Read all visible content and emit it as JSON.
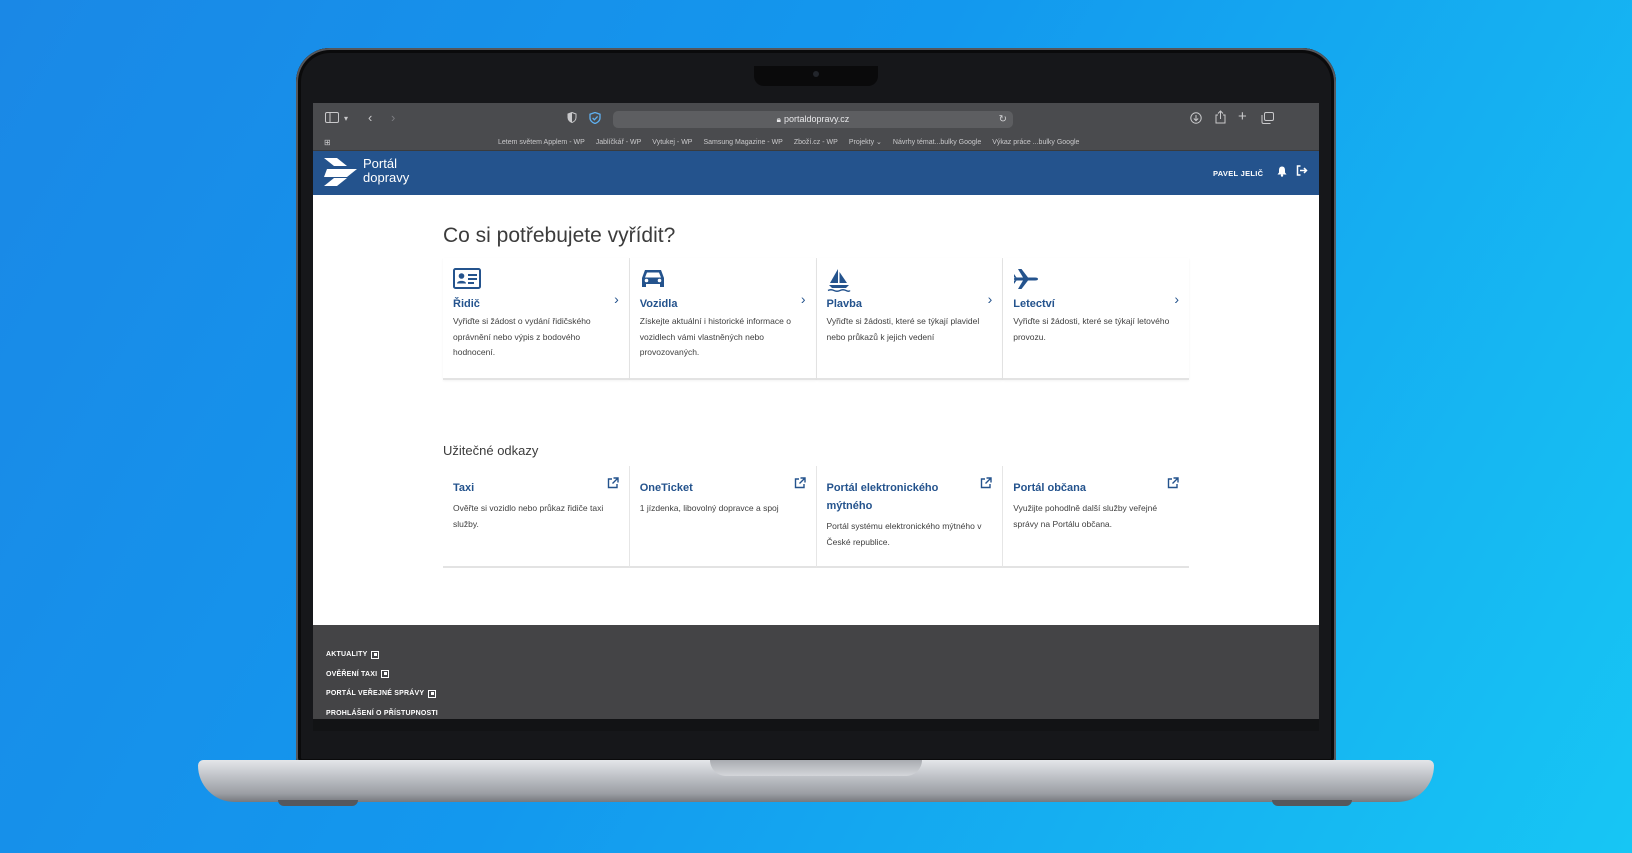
{
  "browser": {
    "url": "portaldopravy.cz",
    "bookmarks": [
      "Letem světem Applem - WP",
      "Jablíčkář - WP",
      "Vytukej - WP",
      "Samsung Magazine - WP",
      "Zboží.cz - WP",
      "Projekty ⌄",
      "Návrhy témat...bulky Google",
      "Výkaz práce ...bulky Google"
    ]
  },
  "header": {
    "logo_line1": "Portál",
    "logo_line2": "dopravy",
    "user_name": "PAVEL JELIČ"
  },
  "main": {
    "title": "Co si potřebujete vyřídit?",
    "services": [
      {
        "title": "Řidič",
        "desc": "Vyřiďte si žádost o vydání řidičského oprávnění nebo výpis z bodového hodnocení.",
        "icon": "driver-license-icon"
      },
      {
        "title": "Vozidla",
        "desc": "Získejte aktuální i historické informace o vozidlech vámi vlastněných nebo provozovaných.",
        "icon": "car-icon"
      },
      {
        "title": "Plavba",
        "desc": "Vyřiďte si žádosti, které se týkají plavidel nebo průkazů k jejich vedení",
        "icon": "sailboat-icon"
      },
      {
        "title": "Letectví",
        "desc": "Vyřiďte si žádosti, které se týkají letového provozu.",
        "icon": "airplane-icon"
      }
    ],
    "links_title": "Užitečné odkazy",
    "links": [
      {
        "title": "Taxi",
        "desc": "Ověřte si vozidlo nebo průkaz řidiče taxi služby."
      },
      {
        "title": "OneTicket",
        "desc": "1 jízdenka, libovolný dopravce a spoj"
      },
      {
        "title": "Portál elektronického mýtného",
        "desc": "Portál systému elektronického mýtného v České republice."
      },
      {
        "title": "Portál občana",
        "desc": "Využijte pohodlně další služby veřejné správy na Portálu občana."
      }
    ]
  },
  "footer": {
    "links": [
      "AKTUALITY",
      "OVĚŘENÍ TAXI",
      "PORTÁL VEŘEJNÉ SPRÁVY",
      "PROHLÁŠENÍ O PŘÍSTUPNOSTI"
    ]
  },
  "colors": {
    "brand": "#24538d",
    "footer": "#444446",
    "browser_chrome": "#4a4b4e"
  }
}
